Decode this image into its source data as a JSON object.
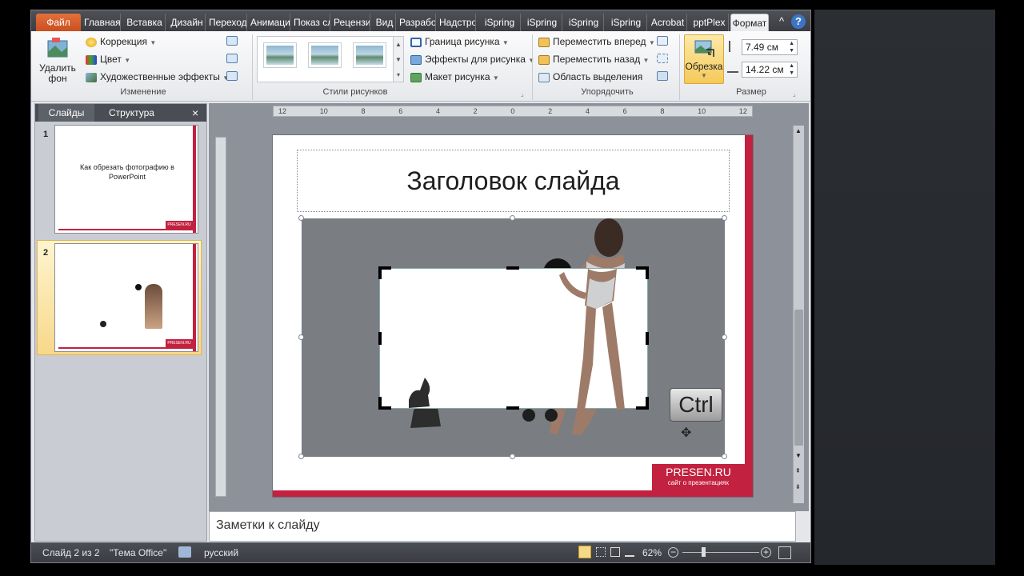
{
  "tabs": [
    "Файл",
    "Главная",
    "Вставка",
    "Дизайн",
    "Переходы",
    "Анимация",
    "Показ слайдов",
    "Рецензирование",
    "Вид",
    "Разработчик",
    "Надстройки",
    "iSpring",
    "iSpring",
    "iSpring",
    "iSpring",
    "Acrobat",
    "pptPlex",
    "Формат"
  ],
  "help_icons": {
    "collapse": "^",
    "help": "?"
  },
  "ribbon": {
    "remove_bg": "Удалить фон",
    "correction": "Коррекция",
    "color": "Цвет",
    "art_effects": "Художественные эффекты",
    "group_change": "Изменение",
    "picture_border": "Граница рисунка",
    "picture_effects": "Эффекты для рисунка",
    "picture_layout": "Макет рисунка",
    "group_styles": "Стили рисунков",
    "bring_forward": "Переместить вперед",
    "send_backward": "Переместить назад",
    "selection_pane": "Область выделения",
    "group_arrange": "Упорядочить",
    "crop": "Обрезка",
    "height": "7.49 см",
    "width": "14.22 см",
    "group_size": "Размер"
  },
  "left_panel": {
    "tab_slides": "Слайды",
    "tab_outline": "Структура",
    "close": "×",
    "slides": [
      {
        "number": "1",
        "text": "Как обрезать фотографию в PowerPoint",
        "brand": "PRESEN.RU"
      },
      {
        "number": "2",
        "brand": "PRESEN.RU"
      }
    ]
  },
  "ruler": {
    "ticks": [
      "12",
      "10",
      "8",
      "6",
      "4",
      "2",
      "0",
      "2",
      "4",
      "6",
      "8",
      "10",
      "12"
    ]
  },
  "slide": {
    "title": "Заголовок слайда",
    "ctrl_key": "Ctrl",
    "brand": "PRESEN.RU",
    "brand_sub": "сайт о презентациях"
  },
  "notes": {
    "placeholder": "Заметки к слайду"
  },
  "status": {
    "slide_info": "Слайд 2 из 2",
    "theme": "\"Тема Office\"",
    "language": "русский",
    "zoom": "62%"
  },
  "colors": {
    "accent_red": "#c2213f",
    "file_tab": "#d85a2a",
    "crop_selected": "#f5d88a"
  }
}
